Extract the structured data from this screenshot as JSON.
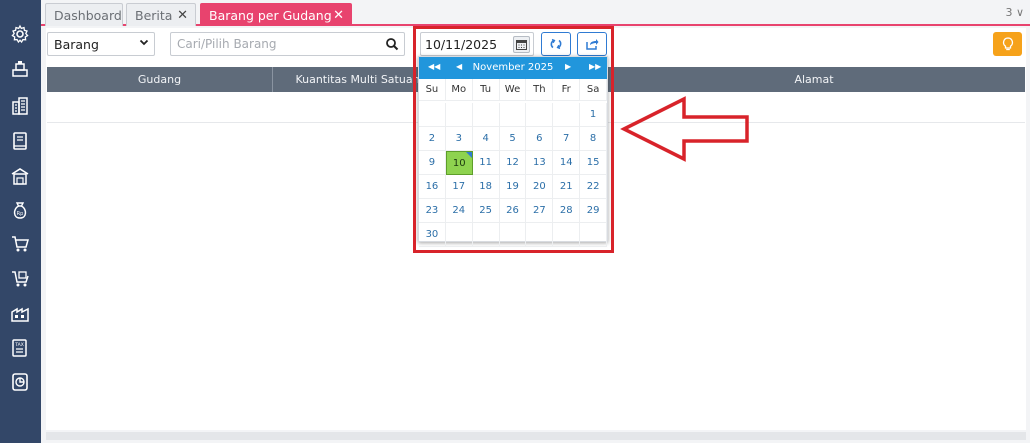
{
  "tabs": [
    {
      "label": "Dashboard",
      "closable": false,
      "active": false
    },
    {
      "label": "Berita",
      "closable": true,
      "active": false
    },
    {
      "label": "Barang per Gudang",
      "closable": true,
      "active": true
    }
  ],
  "tab_close_glyph": "✕",
  "tab_counter": "3 ∨",
  "toolbar": {
    "select_value": "Barang",
    "search_placeholder": "Cari/Pilih Barang",
    "date_value": "10/11/2025"
  },
  "table": {
    "columns": [
      "Gudang",
      "Kuantitas Multi Satuan",
      "Alamat"
    ]
  },
  "datepicker": {
    "nav_prev_year": "◀◀",
    "nav_prev_month": "◀",
    "nav_next_month": "▶",
    "nav_next_year": "▶▶",
    "title": "November 2025",
    "weekdays": [
      "Su",
      "Mo",
      "Tu",
      "We",
      "Th",
      "Fr",
      "Sa"
    ],
    "weeks": [
      [
        "",
        "",
        "",
        "",
        "",
        "",
        "1"
      ],
      [
        "2",
        "3",
        "4",
        "5",
        "6",
        "7",
        "8"
      ],
      [
        "9",
        "10",
        "11",
        "12",
        "13",
        "14",
        "15"
      ],
      [
        "16",
        "17",
        "18",
        "19",
        "20",
        "21",
        "22"
      ],
      [
        "23",
        "24",
        "25",
        "26",
        "27",
        "28",
        "29"
      ],
      [
        "30",
        "",
        "",
        "",
        "",
        "",
        ""
      ]
    ],
    "selected_day": "10"
  },
  "sidebar_icons": [
    "settings-icon",
    "inventory-icon",
    "building-icon",
    "book-icon",
    "warehouse-icon",
    "money-bag-icon",
    "cart-icon",
    "cart-box-icon",
    "factory-icon",
    "tax-icon",
    "report-icon"
  ],
  "colors": {
    "sidebar": "#334768",
    "active_tab": "#e8436e",
    "primary": "#2196dc",
    "highlight": "#d8232a",
    "selected_day": "#8ed34f",
    "hint_button": "#f6a21a"
  }
}
